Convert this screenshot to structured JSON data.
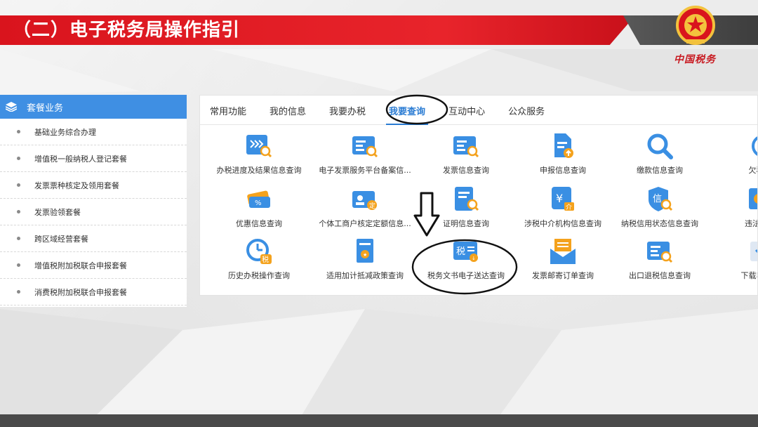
{
  "header": {
    "title": "（二）电子税务局操作指引",
    "brand_sign": "中国税务",
    "accent_color": "#e8242b"
  },
  "sidebar": {
    "title": "套餐业务",
    "header_icon": "stack-icon",
    "items": [
      {
        "label": "基础业务综合办理"
      },
      {
        "label": "增值税一般纳税人登记套餐"
      },
      {
        "label": "发票票种核定及领用套餐"
      },
      {
        "label": "发票验领套餐"
      },
      {
        "label": "跨区域经营套餐"
      },
      {
        "label": "增值税附加税联合申报套餐"
      },
      {
        "label": "消费税附加税联合申报套餐"
      }
    ]
  },
  "tabs": [
    {
      "label": "常用功能"
    },
    {
      "label": "我的信息"
    },
    {
      "label": "我要办税"
    },
    {
      "label": "我要查询",
      "active": true
    },
    {
      "label": "互动中心"
    },
    {
      "label": "公众服务"
    }
  ],
  "functions": [
    {
      "label": "办税进度及结果信息查询",
      "icon": "progress-search-icon"
    },
    {
      "label": "电子发票服务平台备案信...",
      "icon": "invoice-platform-search-icon"
    },
    {
      "label": "发票信息查询",
      "icon": "invoice-search-icon"
    },
    {
      "label": "申报信息查询",
      "icon": "declaration-upload-icon"
    },
    {
      "label": "缴款信息查询",
      "icon": "magnifier-icon"
    },
    {
      "label": "欠税信",
      "icon": "arrears-icon"
    },
    {
      "label": "优惠信息查询",
      "icon": "discount-ticket-icon"
    },
    {
      "label": "个体工商户核定定额信息...",
      "icon": "id-card-icon"
    },
    {
      "label": "证明信息查询",
      "icon": "certificate-search-icon"
    },
    {
      "label": "涉税中介机构信息查询",
      "icon": "yen-agency-icon"
    },
    {
      "label": "纳税信用状态信息查询",
      "icon": "credit-shield-icon"
    },
    {
      "label": "违法违章",
      "icon": "violation-icon"
    },
    {
      "label": "历史办税操作查询",
      "icon": "clock-tax-icon"
    },
    {
      "label": "适用加计抵减政策查询",
      "icon": "policy-document-icon"
    },
    {
      "label": "税务文书电子送达查询",
      "icon": "tax-document-icon"
    },
    {
      "label": "发票邮寄订单查询",
      "icon": "mail-envelope-icon"
    },
    {
      "label": "出口退税信息查询",
      "icon": "export-refund-icon"
    },
    {
      "label": "下载非税收",
      "icon": "download-icon"
    }
  ],
  "colors": {
    "icon_blue": "#3a8fe3",
    "icon_orange": "#f4a21d",
    "tab_active": "#2b7cd3"
  }
}
